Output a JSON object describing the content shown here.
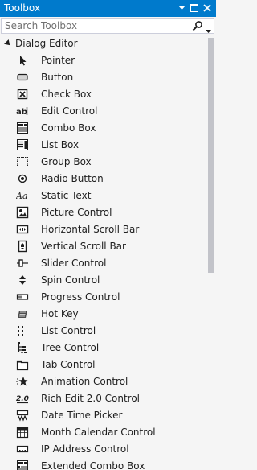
{
  "panel": {
    "title": "Toolbox"
  },
  "search": {
    "placeholder": "Search Toolbox"
  },
  "category": {
    "label": "Dialog Editor"
  },
  "items": [
    {
      "label": "Pointer",
      "icon": "pointer-icon"
    },
    {
      "label": "Button",
      "icon": "button-icon"
    },
    {
      "label": "Check Box",
      "icon": "check-box-icon"
    },
    {
      "label": "Edit Control",
      "icon": "edit-control-icon"
    },
    {
      "label": "Combo Box",
      "icon": "combo-box-icon"
    },
    {
      "label": "List Box",
      "icon": "list-box-icon"
    },
    {
      "label": "Group Box",
      "icon": "group-box-icon"
    },
    {
      "label": "Radio Button",
      "icon": "radio-button-icon"
    },
    {
      "label": "Static Text",
      "icon": "static-text-icon"
    },
    {
      "label": "Picture Control",
      "icon": "picture-control-icon"
    },
    {
      "label": "Horizontal Scroll Bar",
      "icon": "horizontal-scroll-bar-icon"
    },
    {
      "label": "Vertical Scroll Bar",
      "icon": "vertical-scroll-bar-icon"
    },
    {
      "label": "Slider Control",
      "icon": "slider-control-icon"
    },
    {
      "label": "Spin Control",
      "icon": "spin-control-icon"
    },
    {
      "label": "Progress Control",
      "icon": "progress-control-icon"
    },
    {
      "label": "Hot Key",
      "icon": "hot-key-icon"
    },
    {
      "label": "List Control",
      "icon": "list-control-icon"
    },
    {
      "label": "Tree Control",
      "icon": "tree-control-icon"
    },
    {
      "label": "Tab Control",
      "icon": "tab-control-icon"
    },
    {
      "label": "Animation Control",
      "icon": "animation-control-icon"
    },
    {
      "label": "Rich Edit 2.0 Control",
      "icon": "rich-edit-icon"
    },
    {
      "label": "Date Time Picker",
      "icon": "date-time-picker-icon"
    },
    {
      "label": "Month Calendar Control",
      "icon": "month-calendar-icon"
    },
    {
      "label": "IP Address Control",
      "icon": "ip-address-icon"
    },
    {
      "label": "Extended Combo Box",
      "icon": "extended-combo-box-icon"
    }
  ],
  "colors": {
    "accent": "#007acc",
    "background": "#f5f5f5",
    "scroll_thumb": "#c2c3c9"
  }
}
